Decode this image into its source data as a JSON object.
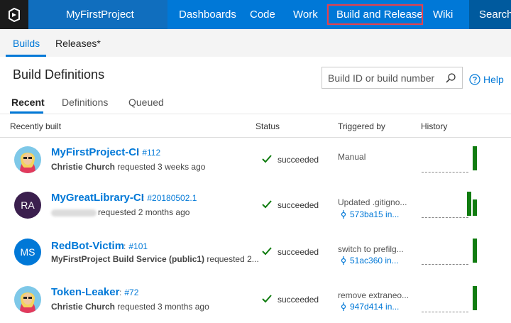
{
  "header": {
    "project_name": "MyFirstProject",
    "nav": [
      "Dashboards",
      "Code",
      "Work",
      "Build and Release",
      "Wiki"
    ],
    "search_label": "Search",
    "highlighted_item": "Build and Release"
  },
  "hub": {
    "tabs": [
      "Builds",
      "Releases*"
    ],
    "active_tab": "Builds"
  },
  "page": {
    "title": "Build Definitions",
    "search_placeholder": "Build ID or build number",
    "help_label": "Help"
  },
  "pivots": {
    "items": [
      "Recent",
      "Definitions",
      "Queued"
    ],
    "active": "Recent"
  },
  "grid": {
    "columns": [
      "Recently built",
      "Status",
      "Triggered by",
      "History"
    ],
    "rows": [
      {
        "name": "MyFirstProject-CI",
        "build_number": "#112",
        "requester": "Christie Church",
        "requested_text": " requested 3 weeks ago",
        "status": "succeeded",
        "trigger": "Manual",
        "commit": "",
        "avatar": "photo",
        "history": [
          1.0
        ]
      },
      {
        "name": "MyGreatLibrary-CI",
        "build_number": "#20180502.1",
        "requester": "",
        "requested_text": "requested 2 months ago",
        "status": "succeeded",
        "trigger": "Updated .gitigno...",
        "commit": "573ba15 in...",
        "avatar": "RA",
        "avatar_color": "#3b1f4e",
        "history": [
          0.95,
          0.65
        ]
      },
      {
        "name": "RedBot-Victim",
        "build_number": "#101",
        "requester": "MyFirstProject Build Service (public1)",
        "requested_text": " requested 2...",
        "status": "succeeded",
        "trigger": "switch to prefilg...",
        "commit": "51ac360 in...",
        "avatar": "MS",
        "avatar_color": "#0078d7",
        "history": [
          1.0
        ]
      },
      {
        "name": "Token-Leaker",
        "build_number": "#72",
        "requester": "Christie Church",
        "requested_text": " requested 3 months ago",
        "status": "succeeded",
        "trigger": "remove extraneo...",
        "commit": "947d414 in...",
        "avatar": "photo",
        "history": [
          1.0
        ]
      }
    ]
  },
  "colors": {
    "brand_blue": "#0078d7",
    "success_green": "#107c10",
    "highlight_red": "#e8404a"
  },
  "icons": {
    "logo": "vsts-logo-icon",
    "search": "search-icon",
    "help": "help-circle-icon",
    "status": "checkmark-icon",
    "commit": "commit-icon"
  }
}
